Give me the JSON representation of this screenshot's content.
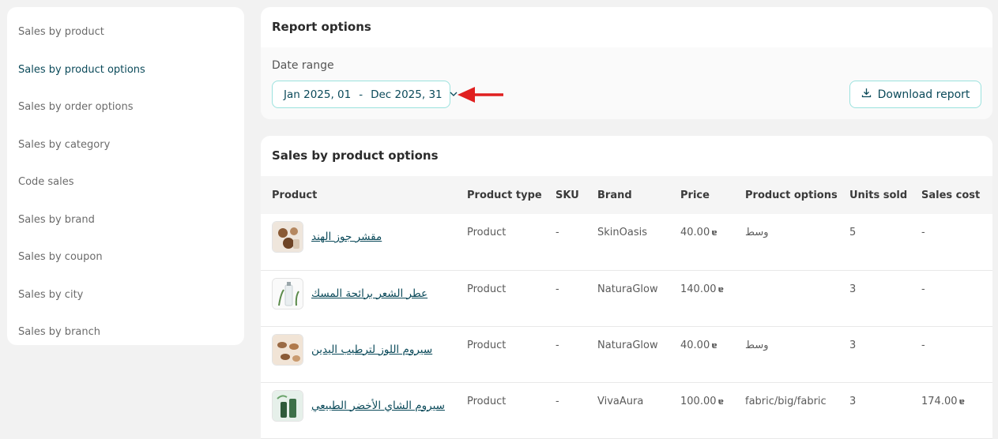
{
  "sidebar": {
    "items": [
      {
        "label": "Sales by product"
      },
      {
        "label": "Sales by product options"
      },
      {
        "label": "Sales by order options"
      },
      {
        "label": "Sales by category"
      },
      {
        "label": "Code sales"
      },
      {
        "label": "Sales by brand"
      },
      {
        "label": "Sales by coupon"
      },
      {
        "label": "Sales by city"
      },
      {
        "label": "Sales by branch"
      }
    ],
    "active_index": 1
  },
  "report_options": {
    "title": "Report options",
    "date_range_label": "Date range",
    "date_start": "Jan 2025, 01",
    "date_separator": "-",
    "date_end": "Dec 2025, 31",
    "download_label": "Download report"
  },
  "table": {
    "title": "Sales by product options",
    "columns": [
      "Product",
      "Product type",
      "SKU",
      "Brand",
      "Price",
      "Product options",
      "Units sold",
      "Sales cost"
    ],
    "currency_symbol": "ɐ",
    "rows": [
      {
        "name": "مقشر جوز الهند",
        "type": "Product",
        "sku": "-",
        "brand": "SkinOasis",
        "price": "40.00",
        "options": "وسط",
        "units": "5",
        "cost": "-",
        "cost_currency": ""
      },
      {
        "name": "عطر الشعر برائحة المسك",
        "type": "Product",
        "sku": "-",
        "brand": "NaturaGlow",
        "price": "140.00",
        "options": "",
        "units": "3",
        "cost": "-",
        "cost_currency": ""
      },
      {
        "name": "سيروم اللوز لترطيب اليدين",
        "type": "Product",
        "sku": "-",
        "brand": "NaturaGlow",
        "price": "40.00",
        "options": "وسط",
        "units": "3",
        "cost": "-",
        "cost_currency": ""
      },
      {
        "name": "سيروم الشاي الأخضر الطبيعي",
        "type": "Product",
        "sku": "-",
        "brand": "VivaAura",
        "price": "100.00",
        "options": "fabric/big/fabric",
        "units": "3",
        "cost": "174.00",
        "cost_currency": "ɐ"
      }
    ]
  },
  "colors": {
    "accent": "#0b4a5a",
    "border_accent": "#9be2de",
    "annotation_arrow": "#e02020"
  }
}
